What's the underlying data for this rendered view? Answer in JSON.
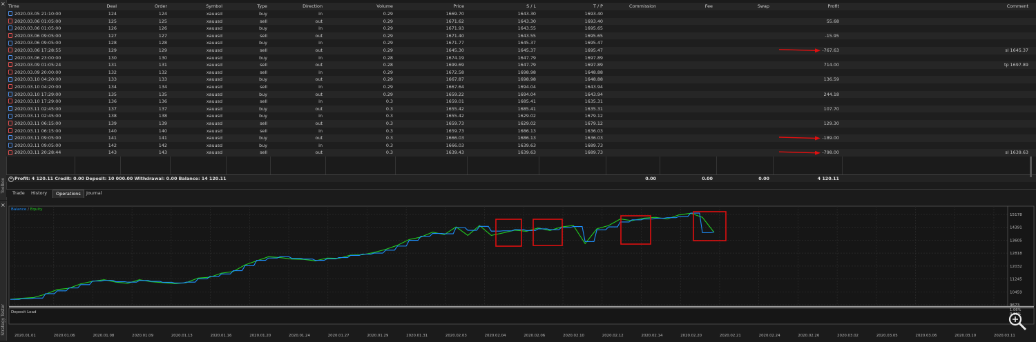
{
  "toolbox_label": "Toolbox",
  "tester_label": "Strategy Tester",
  "columns": [
    "Time",
    "Deal",
    "Order",
    "Symbol",
    "Type",
    "Direction",
    "Volume",
    "Price",
    "S / L",
    "T / P",
    "Commission",
    "Fee",
    "Swap",
    "Profit",
    "Comment"
  ],
  "rows": [
    {
      "time": "2020.03.05 21:10:00",
      "deal": "124",
      "order": "124",
      "symbol": "xauusd",
      "type": "buy",
      "direction": "in",
      "volume": "0.29",
      "price": "1669.70",
      "sl": "1643.30",
      "tp": "1693.40",
      "profit": "",
      "comment": ""
    },
    {
      "time": "2020.03.06 01:05:00",
      "deal": "125",
      "order": "125",
      "symbol": "xauusd",
      "type": "sell",
      "direction": "out",
      "volume": "0.29",
      "price": "1671.62",
      "sl": "1643.30",
      "tp": "1693.40",
      "profit": "55.68",
      "comment": ""
    },
    {
      "time": "2020.03.06 01:05:00",
      "deal": "126",
      "order": "126",
      "symbol": "xauusd",
      "type": "buy",
      "direction": "in",
      "volume": "0.29",
      "price": "1671.93",
      "sl": "1643.55",
      "tp": "1695.65",
      "profit": "",
      "comment": ""
    },
    {
      "time": "2020.03.06 09:05:00",
      "deal": "127",
      "order": "127",
      "symbol": "xauusd",
      "type": "sell",
      "direction": "out",
      "volume": "0.29",
      "price": "1671.40",
      "sl": "1643.55",
      "tp": "1695.65",
      "profit": "-15.95",
      "comment": ""
    },
    {
      "time": "2020.03.06 09:05:00",
      "deal": "128",
      "order": "128",
      "symbol": "xauusd",
      "type": "buy",
      "direction": "in",
      "volume": "0.29",
      "price": "1671.77",
      "sl": "1645.37",
      "tp": "1695.47",
      "profit": "",
      "comment": ""
    },
    {
      "time": "2020.03.06 17:28:55",
      "deal": "129",
      "order": "129",
      "symbol": "xauusd",
      "type": "sell",
      "direction": "out",
      "volume": "0.29",
      "price": "1645.30",
      "sl": "1645.37",
      "tp": "1695.47",
      "profit": "-767.63",
      "comment": "sl 1645.37"
    },
    {
      "time": "2020.03.06 23:00:00",
      "deal": "130",
      "order": "130",
      "symbol": "xauusd",
      "type": "buy",
      "direction": "in",
      "volume": "0.28",
      "price": "1674.19",
      "sl": "1647.79",
      "tp": "1697.89",
      "profit": "",
      "comment": ""
    },
    {
      "time": "2020.03.09 01:05:24",
      "deal": "131",
      "order": "131",
      "symbol": "xauusd",
      "type": "sell",
      "direction": "out",
      "volume": "0.28",
      "price": "1699.69",
      "sl": "1647.79",
      "tp": "1697.89",
      "profit": "714.00",
      "comment": "tp 1697.89"
    },
    {
      "time": "2020.03.09 20:00:00",
      "deal": "132",
      "order": "132",
      "symbol": "xauusd",
      "type": "sell",
      "direction": "in",
      "volume": "0.29",
      "price": "1672.58",
      "sl": "1698.98",
      "tp": "1648.88",
      "profit": "",
      "comment": ""
    },
    {
      "time": "2020.03.10 04:20:00",
      "deal": "133",
      "order": "133",
      "symbol": "xauusd",
      "type": "buy",
      "direction": "out",
      "volume": "0.29",
      "price": "1667.87",
      "sl": "1698.98",
      "tp": "1648.88",
      "profit": "136.59",
      "comment": ""
    },
    {
      "time": "2020.03.10 04:20:00",
      "deal": "134",
      "order": "134",
      "symbol": "xauusd",
      "type": "sell",
      "direction": "in",
      "volume": "0.29",
      "price": "1667.64",
      "sl": "1694.04",
      "tp": "1643.94",
      "profit": "",
      "comment": ""
    },
    {
      "time": "2020.03.10 17:29:00",
      "deal": "135",
      "order": "135",
      "symbol": "xauusd",
      "type": "buy",
      "direction": "out",
      "volume": "0.29",
      "price": "1659.22",
      "sl": "1694.04",
      "tp": "1643.94",
      "profit": "244.18",
      "comment": ""
    },
    {
      "time": "2020.03.10 17:29:00",
      "deal": "136",
      "order": "136",
      "symbol": "xauusd",
      "type": "sell",
      "direction": "in",
      "volume": "0.3",
      "price": "1659.01",
      "sl": "1685.41",
      "tp": "1635.31",
      "profit": "",
      "comment": ""
    },
    {
      "time": "2020.03.11 02:45:00",
      "deal": "137",
      "order": "137",
      "symbol": "xauusd",
      "type": "buy",
      "direction": "out",
      "volume": "0.3",
      "price": "1655.42",
      "sl": "1685.41",
      "tp": "1635.31",
      "profit": "107.70",
      "comment": ""
    },
    {
      "time": "2020.03.11 02:45:00",
      "deal": "138",
      "order": "138",
      "symbol": "xauusd",
      "type": "buy",
      "direction": "in",
      "volume": "0.3",
      "price": "1655.42",
      "sl": "1629.02",
      "tp": "1679.12",
      "profit": "",
      "comment": ""
    },
    {
      "time": "2020.03.11 06:15:00",
      "deal": "139",
      "order": "139",
      "symbol": "xauusd",
      "type": "sell",
      "direction": "out",
      "volume": "0.3",
      "price": "1659.73",
      "sl": "1629.02",
      "tp": "1679.12",
      "profit": "129.30",
      "comment": ""
    },
    {
      "time": "2020.03.11 06:15:00",
      "deal": "140",
      "order": "140",
      "symbol": "xauusd",
      "type": "sell",
      "direction": "in",
      "volume": "0.3",
      "price": "1659.73",
      "sl": "1686.13",
      "tp": "1636.03",
      "profit": "",
      "comment": ""
    },
    {
      "time": "2020.03.11 09:05:00",
      "deal": "141",
      "order": "141",
      "symbol": "xauusd",
      "type": "buy",
      "direction": "out",
      "volume": "0.3",
      "price": "1666.03",
      "sl": "1686.13",
      "tp": "1636.03",
      "profit": "-189.00",
      "comment": ""
    },
    {
      "time": "2020.03.11 09:05:00",
      "deal": "142",
      "order": "142",
      "symbol": "xauusd",
      "type": "buy",
      "direction": "in",
      "volume": "0.3",
      "price": "1666.03",
      "sl": "1639.63",
      "tp": "1689.73",
      "profit": "",
      "comment": ""
    },
    {
      "time": "2020.03.11 20:28:44",
      "deal": "143",
      "order": "143",
      "symbol": "xauusd",
      "type": "sell",
      "direction": "out",
      "volume": "0.3",
      "price": "1639.43",
      "sl": "1639.63",
      "tp": "1689.73",
      "profit": "-798.00",
      "comment": "sl 1639.63"
    }
  ],
  "summary": {
    "text": "Profit: 4 120.11  Credit: 0.00  Deposit: 10 000.00  Withdrawal: 0.00  Balance: 14 120.11",
    "commission": "0.00",
    "fee": "0.00",
    "swap": "0.00",
    "profit": "4 120.11"
  },
  "arrow_color": "#e01010",
  "tabs": [
    {
      "label": "Trade",
      "active": false
    },
    {
      "label": "History",
      "active": false
    },
    {
      "label": "Operations",
      "active": true
    },
    {
      "label": "Journal",
      "active": false
    }
  ],
  "chart_data": {
    "type": "line",
    "legend": [
      "Balance",
      "Equity"
    ],
    "series": [
      {
        "name": "Balance",
        "color": "#1e90ff",
        "values": [
          10000,
          10050,
          10080,
          10350,
          10520,
          10700,
          10900,
          11120,
          11160,
          11080,
          11050,
          11150,
          11100,
          11040,
          11000,
          11050,
          11250,
          11400,
          11550,
          11750,
          12050,
          12380,
          12520,
          12600,
          12500,
          12460,
          12380,
          12470,
          12550,
          12680,
          12760,
          12820,
          13000,
          13250,
          13600,
          13850,
          14020,
          14000,
          14380,
          14210,
          14450,
          14160,
          14180,
          14250,
          14200,
          14300,
          14250,
          14390,
          14440,
          13520,
          14240,
          14420,
          14720,
          14850,
          14900,
          14950,
          14980,
          15050,
          15260,
          14070,
          14120
        ]
      },
      {
        "name": "Equity",
        "color": "#22cc22",
        "values": [
          10000,
          10070,
          10120,
          10320,
          10600,
          10680,
          10950,
          11100,
          11200,
          11050,
          10980,
          11200,
          11080,
          11020,
          10960,
          11020,
          11300,
          11350,
          11600,
          11700,
          12100,
          12350,
          12600,
          12550,
          12460,
          12440,
          12350,
          12520,
          12500,
          12700,
          12720,
          12860,
          13050,
          13300,
          13650,
          13800,
          14100,
          13950,
          14420,
          13900,
          14500,
          13900,
          14050,
          14220,
          14150,
          14350,
          14200,
          14420,
          14500,
          13400,
          14300,
          14500,
          14900,
          14800,
          14950,
          15000,
          14900,
          15150,
          15250,
          15000,
          14080
        ]
      }
    ],
    "y_ticks": [
      "15178",
      "14391",
      "13605",
      "12818",
      "12032",
      "11245",
      "10459",
      "9673"
    ],
    "deposit_load_ticks": [
      "1.06%",
      "0.00%"
    ],
    "deposit_load_label": "Deposit Load",
    "x_ticks": [
      "2020.01.01",
      "2020.01.06",
      "2020.01.08",
      "2020.01.09",
      "2020.01.13",
      "2020.01.16",
      "2020.01.20",
      "2020.01.24",
      "2020.01.27",
      "2020.01.29",
      "2020.01.31",
      "2020.02.03",
      "2020.02.04",
      "2020.02.06",
      "2020.02.10",
      "2020.02.12",
      "2020.02.14",
      "2020.02.20",
      "2020.02.21",
      "2020.02.24",
      "2020.02.26",
      "2020.03.02",
      "2020.03.05",
      "2020.03.06",
      "2020.03.10",
      "2020.03.11"
    ],
    "highlight_color": "#e01010",
    "grid": true
  }
}
